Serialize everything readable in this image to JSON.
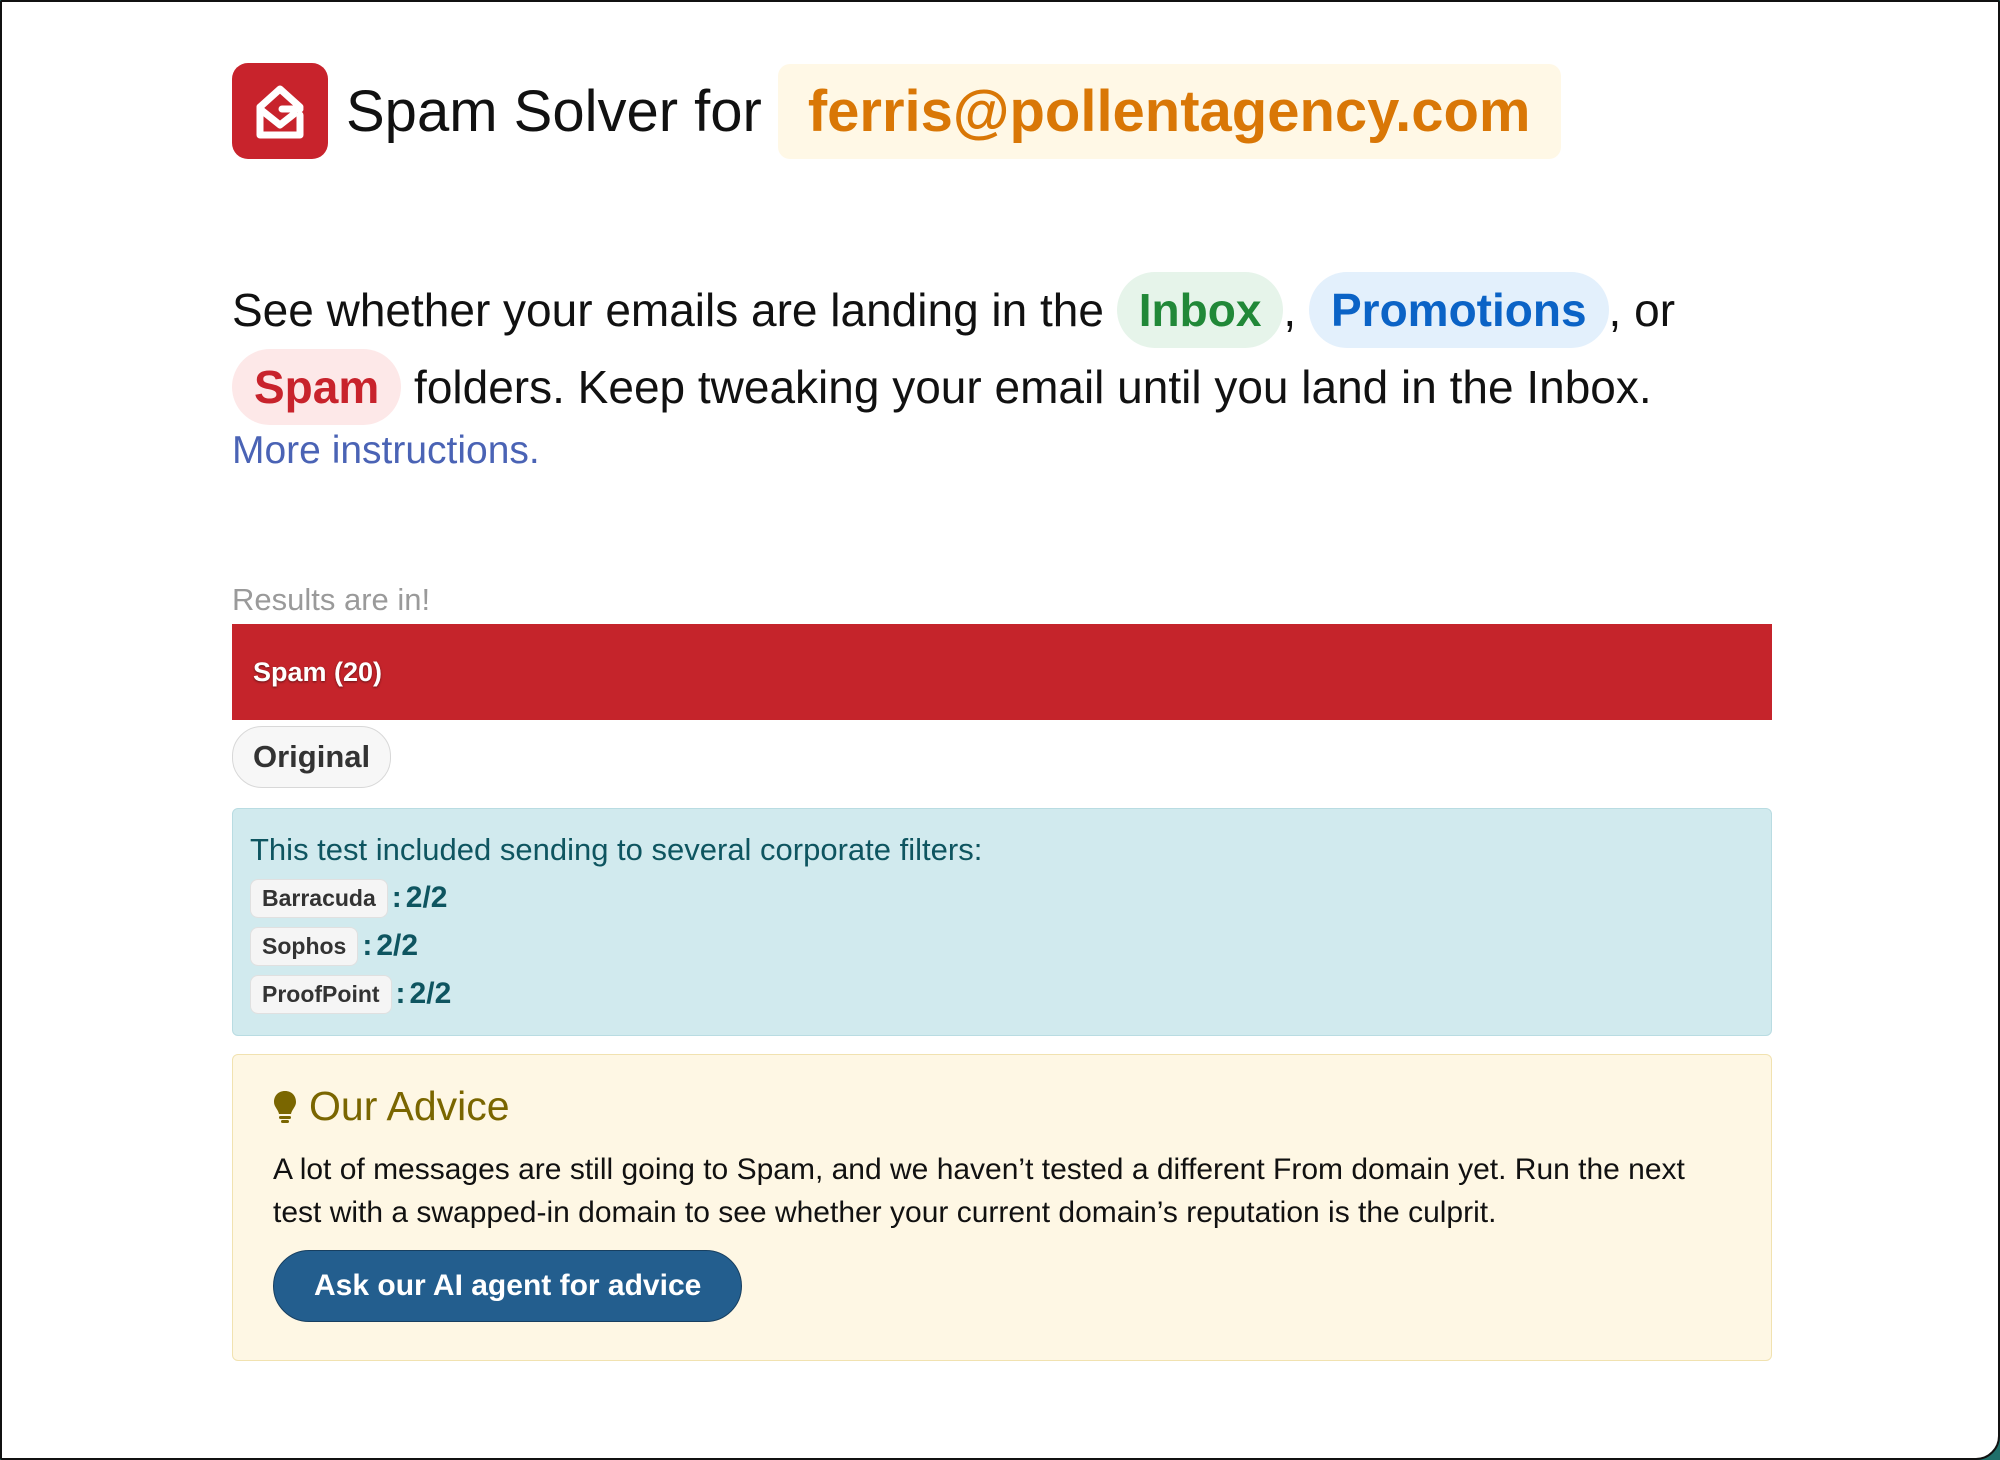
{
  "header": {
    "title": "Spam Solver for",
    "email": "ferris@pollentagency.com",
    "logo_icon": "mail-house-icon",
    "brand_color": "#c8232c"
  },
  "intro": {
    "part1": "See whether your emails are landing in the",
    "inbox": "Inbox",
    "comma": ",",
    "promotions": "Promotions",
    "or": ", or",
    "spam": "Spam",
    "part2": "folders. Keep tweaking your email until you land in the Inbox.",
    "more_link": "More instructions."
  },
  "results": {
    "label": "Results are in!",
    "bar_label": "Spam (20)",
    "bar_color": "#c5242b",
    "tag": "Original"
  },
  "filters": {
    "title": "This test included sending to several corporate filters:",
    "items": [
      {
        "name": "Barracuda",
        "sep": ":",
        "score": "2/2"
      },
      {
        "name": "Sophos",
        "sep": ":",
        "score": "2/2"
      },
      {
        "name": "ProofPoint",
        "sep": ":",
        "score": "2/2"
      }
    ]
  },
  "advice": {
    "icon": "lightbulb-icon",
    "title": "Our Advice",
    "text": "A lot of messages are still going to Spam, and we haven’t tested a different From domain yet. Run the next test with a swapped-in domain to see whether your current domain’s reputation is the culprit.",
    "button": "Ask our AI agent for advice"
  }
}
